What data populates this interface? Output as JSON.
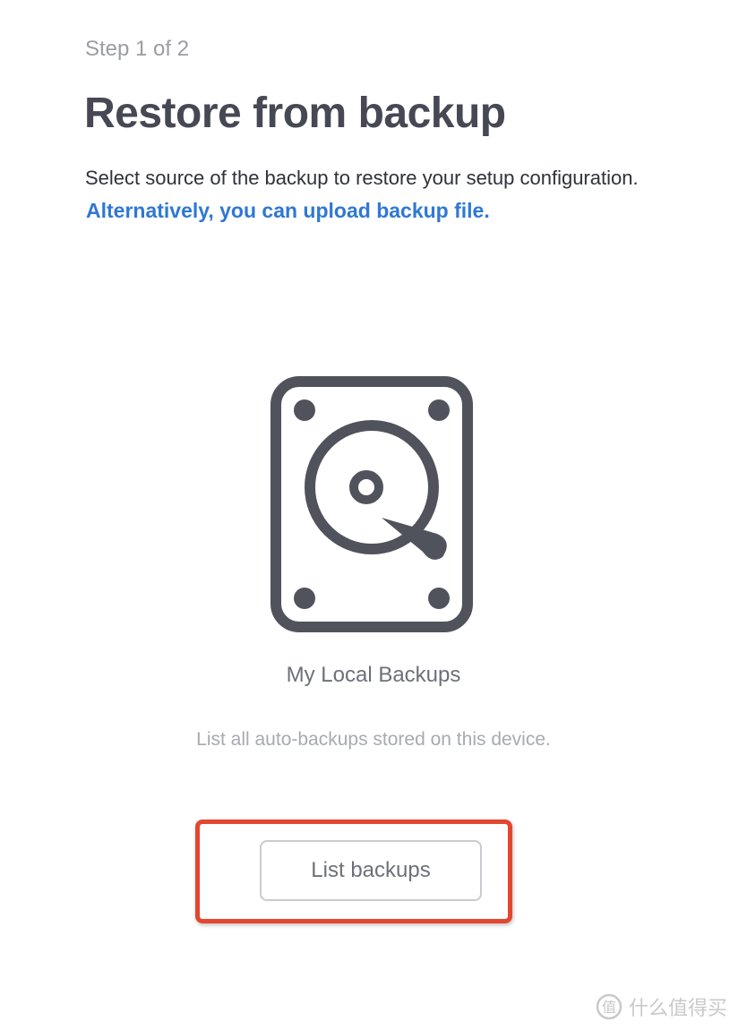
{
  "header": {
    "step": "Step 1 of 2",
    "title": "Restore from backup",
    "description": "Select source of the backup to restore your setup configuration.",
    "alt_link": "Alternatively, you can upload backup file."
  },
  "source": {
    "icon": "hard-drive-icon",
    "name": "My Local Backups",
    "description": "List all auto-backups stored on this device.",
    "button_label": "List backups"
  },
  "watermark": {
    "text": "什么值得买"
  },
  "colors": {
    "link": "#2f78d4",
    "title": "#464954",
    "highlight": "#e4462f",
    "icon": "#50535c"
  }
}
